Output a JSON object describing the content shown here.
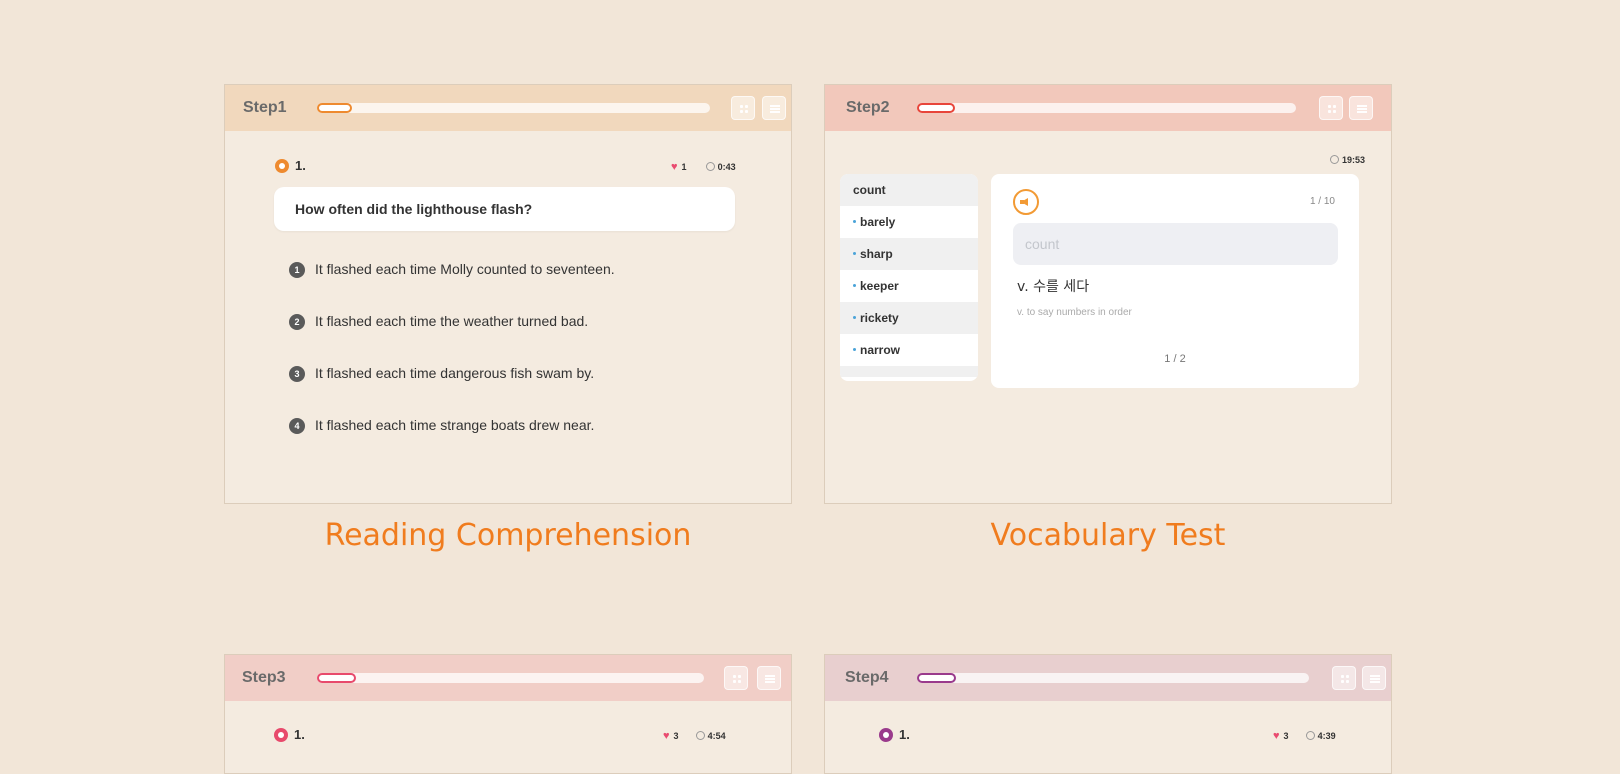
{
  "panels": {
    "step1": {
      "label": "Step1",
      "progress": 0.09,
      "question_number": "1.",
      "lives": "1",
      "time": "0:43",
      "question": "How often did the lighthouse flash?",
      "options": [
        {
          "num": "1",
          "text": "It flashed each time Molly counted to seventeen."
        },
        {
          "num": "2",
          "text": "It flashed each time the weather turned bad."
        },
        {
          "num": "3",
          "text": "It flashed each time dangerous fish swam by."
        },
        {
          "num": "4",
          "text": "It flashed each time strange boats drew near."
        }
      ],
      "caption": "Reading Comprehension"
    },
    "step2": {
      "label": "Step2",
      "progress": 0.1,
      "time": "19:53",
      "words": [
        "count",
        "barely",
        "sharp",
        "keeper",
        "rickety",
        "narrow"
      ],
      "card": {
        "count": "1 / 10",
        "input_placeholder": "count",
        "meaning": "v. 수를 세다",
        "definition": "v. to say numbers in order",
        "page": "1  / 2"
      },
      "caption": "Vocabulary Test"
    },
    "step3": {
      "label": "Step3",
      "progress": 0.1,
      "question_number": "1.",
      "lives": "3",
      "time": "4:54"
    },
    "step4": {
      "label": "Step4",
      "progress": 0.1,
      "question_number": "1.",
      "lives": "3",
      "time": "4:39"
    }
  },
  "colors": {
    "step1_header": "#f1d8bd",
    "step1_accent": "#ee8a2f",
    "step2_header": "#f2c8bb",
    "step2_accent": "#e8453a",
    "step3_header": "#f1cec7",
    "step3_accent": "#e84a6c",
    "step4_header": "#e8cfcf",
    "step4_accent": "#9a3a8c",
    "caption": "#f07c1e"
  },
  "icons": {
    "grid": "grid-icon",
    "list": "list-icon",
    "heart": "heart-icon",
    "timer": "timer-icon",
    "speaker": "speaker-icon"
  }
}
